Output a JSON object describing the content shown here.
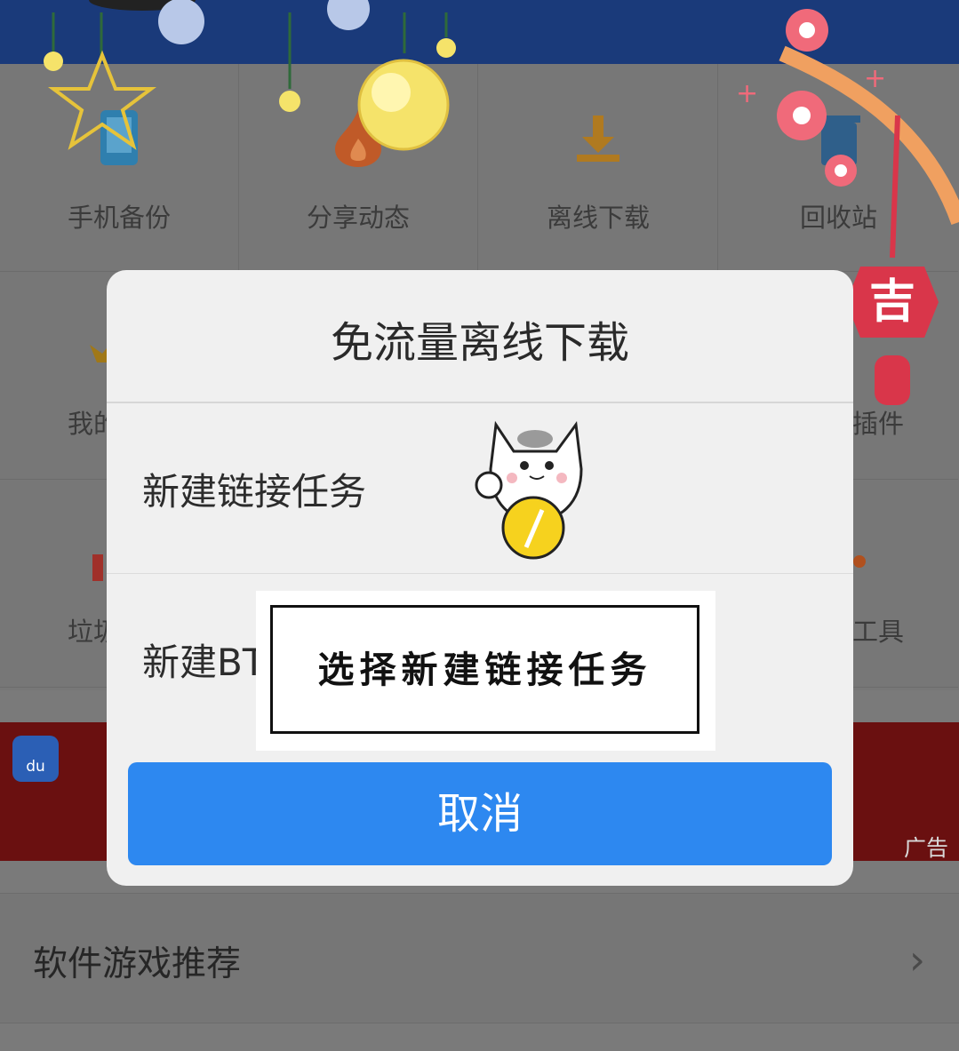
{
  "grid": {
    "row1": [
      {
        "label": "手机备份",
        "icon": "phone-backup-icon"
      },
      {
        "label": "分享动态",
        "icon": "flame-icon"
      },
      {
        "label": "离线下载",
        "icon": "download-icon"
      },
      {
        "label": "回收站",
        "icon": "trash-icon"
      }
    ],
    "row2_left_partial": "我的",
    "row2_right_partial": "插件",
    "row3_left_partial": "垃圾",
    "row3_right_partial": "工具"
  },
  "banner": {
    "ad_tag": "广告",
    "logo_text": "du"
  },
  "list": {
    "label": "软件游戏推荐"
  },
  "dialog": {
    "title": "免流量离线下载",
    "option1": "新建链接任务",
    "option2": "新建BT",
    "cancel": "取消"
  },
  "annotation": {
    "text": "选择新建链接任务"
  },
  "decor": {
    "lucky_char": "吉"
  },
  "colors": {
    "accent": "#2d88f0",
    "topbar": "#1a3a7a",
    "overlay": "#777777",
    "festive_red": "#d9364a"
  }
}
